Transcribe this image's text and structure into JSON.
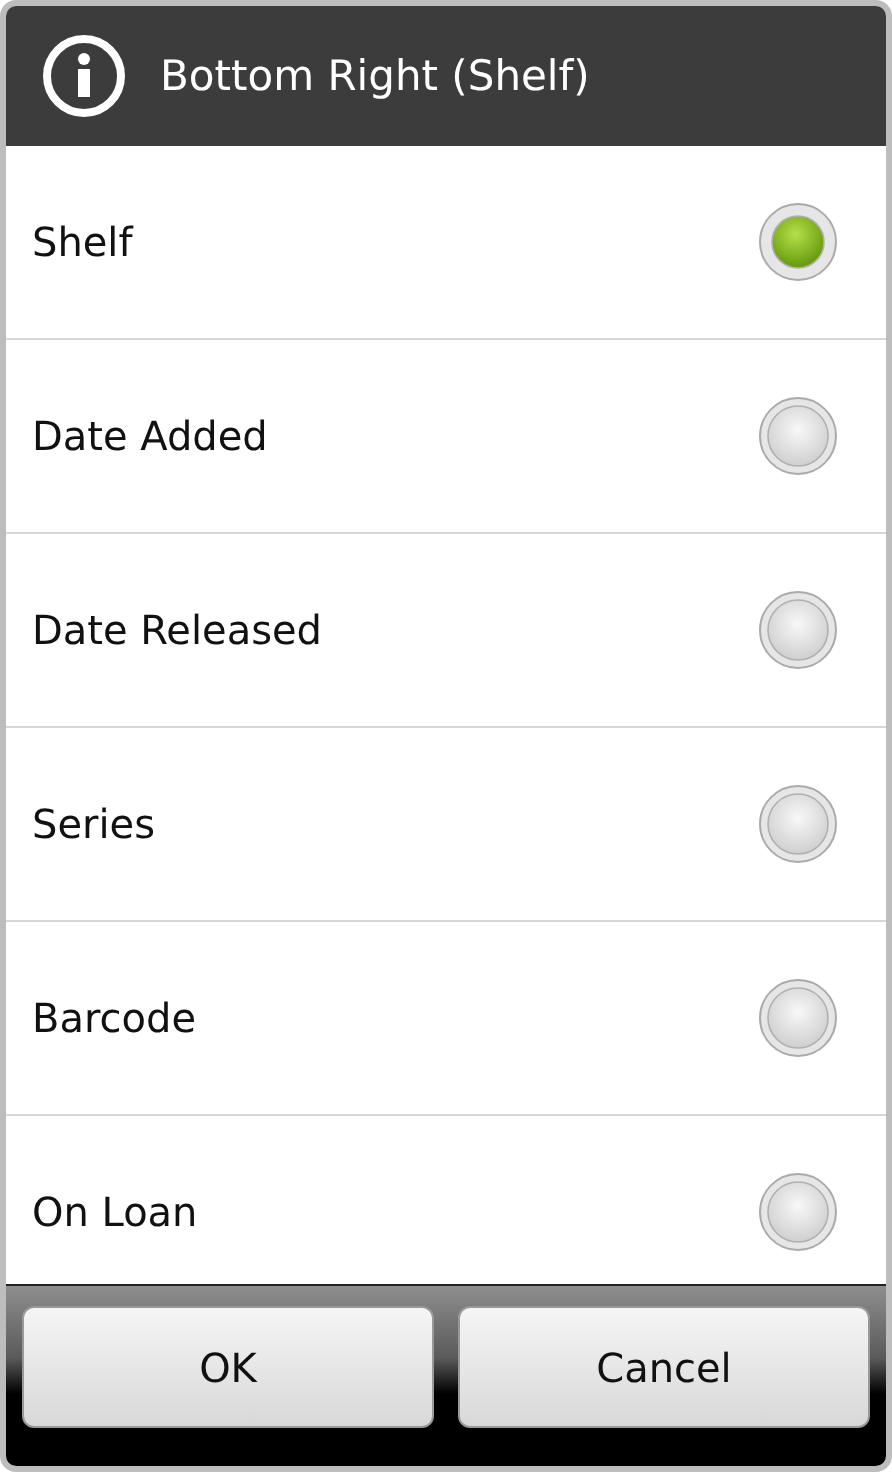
{
  "dialog": {
    "title": "Bottom Right (Shelf)"
  },
  "options": [
    {
      "label": "Shelf",
      "selected": true
    },
    {
      "label": "Date Added",
      "selected": false
    },
    {
      "label": "Date Released",
      "selected": false
    },
    {
      "label": "Series",
      "selected": false
    },
    {
      "label": "Barcode",
      "selected": false
    },
    {
      "label": "On Loan",
      "selected": false
    }
  ],
  "buttons": [
    "OK",
    "Cancel"
  ]
}
